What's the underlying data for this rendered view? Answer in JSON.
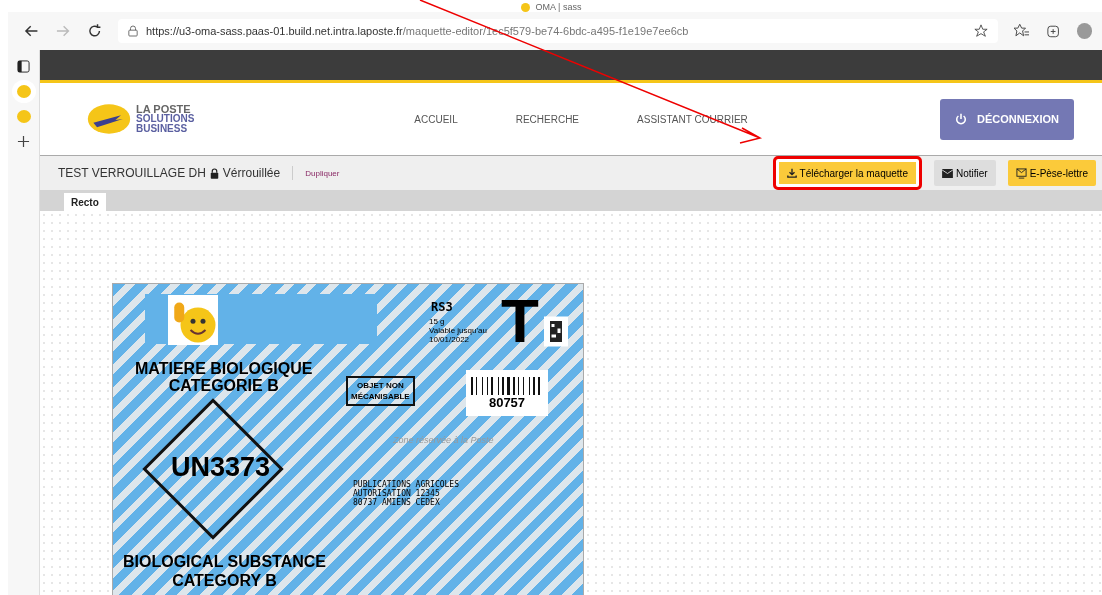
{
  "browser": {
    "tab_title": "OMA | sass",
    "url_host": "https://u3-oma-sass.paas-01.build.net.intra.laposte.fr",
    "url_path": "/maquette-editor/1ec5f579-be74-6bdc-a495-f1e19e7ee6cb"
  },
  "logo": {
    "line_1": "LA POSTE",
    "line_2": "SOLUTIONS",
    "line_3": "BUSINESS"
  },
  "nav": [
    "ACCUEIL",
    "RECHERCHE",
    "ASSISTANT COURRIER"
  ],
  "logout": {
    "label": "DÉCONNEXION"
  },
  "toolbar": {
    "title": "TEST VERROUILLAGE DH",
    "status": "Vérrouillée",
    "locked": true,
    "duplicate": "Dupliquer",
    "buttons": [
      {
        "kind": "download",
        "label": "Télécharger la maquette",
        "highlighted": true
      },
      {
        "kind": "notify",
        "label": "Notifier",
        "highlighted": false
      },
      {
        "kind": "scale",
        "label": "E-Pèse-lettre",
        "highlighted": false
      }
    ]
  },
  "tabs": [
    {
      "label": "Recto",
      "selected": true
    }
  ],
  "envelope": {
    "service": "RS3",
    "weight": "15 g",
    "validity": "Valable jusqu'au",
    "date": "10/01/2022",
    "big_letter": "T",
    "heading_fr": [
      "MATIERE BIOLOGIQUE",
      "CATEGORIE B"
    ],
    "stamp": [
      "OBJET NON",
      "MÉCANISABLE"
    ],
    "barcode_number": "80757",
    "reserved_zone": "Zone réservée à la Poste",
    "un_code": "UN3373",
    "address": [
      "PUBLICATIONS AGRICOLES",
      "AUTORISATION 12345",
      "80737 AMIENS CEDEX"
    ],
    "heading_en": [
      "BIOLOGICAL SUBSTANCE",
      "CATEGORY B"
    ]
  }
}
